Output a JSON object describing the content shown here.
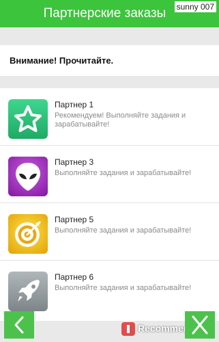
{
  "header": {
    "title": "Партнерские заказы"
  },
  "watermark_user": "sunny 007",
  "notice": {
    "text": "Внимание! Прочитайте."
  },
  "partners": [
    {
      "title": "Партнер 1",
      "description": "Рекомендуем! Выполняйте задания и зарабатывайте!",
      "icon": "star-icon",
      "color": "#27c07a"
    },
    {
      "title": "Партнер 3",
      "description": "Выполняйте задания и зарабатывайте!",
      "icon": "alien-icon",
      "color": "#a52cc4"
    },
    {
      "title": "Партнер 5",
      "description": "Выполняйте задания и зарабатывайте!",
      "icon": "target-icon",
      "color": "#f0c20f"
    },
    {
      "title": "Партнер 6",
      "description": "Выполняйте задания и зарабатывайте!",
      "icon": "rocket-icon",
      "color": "#8f9699"
    }
  ],
  "navigation": {
    "back_icon": "chevron-left-icon",
    "close_icon": "close-icon",
    "accent": "#4cc24c"
  },
  "watermark_site": {
    "text": "Recommend.ru"
  }
}
